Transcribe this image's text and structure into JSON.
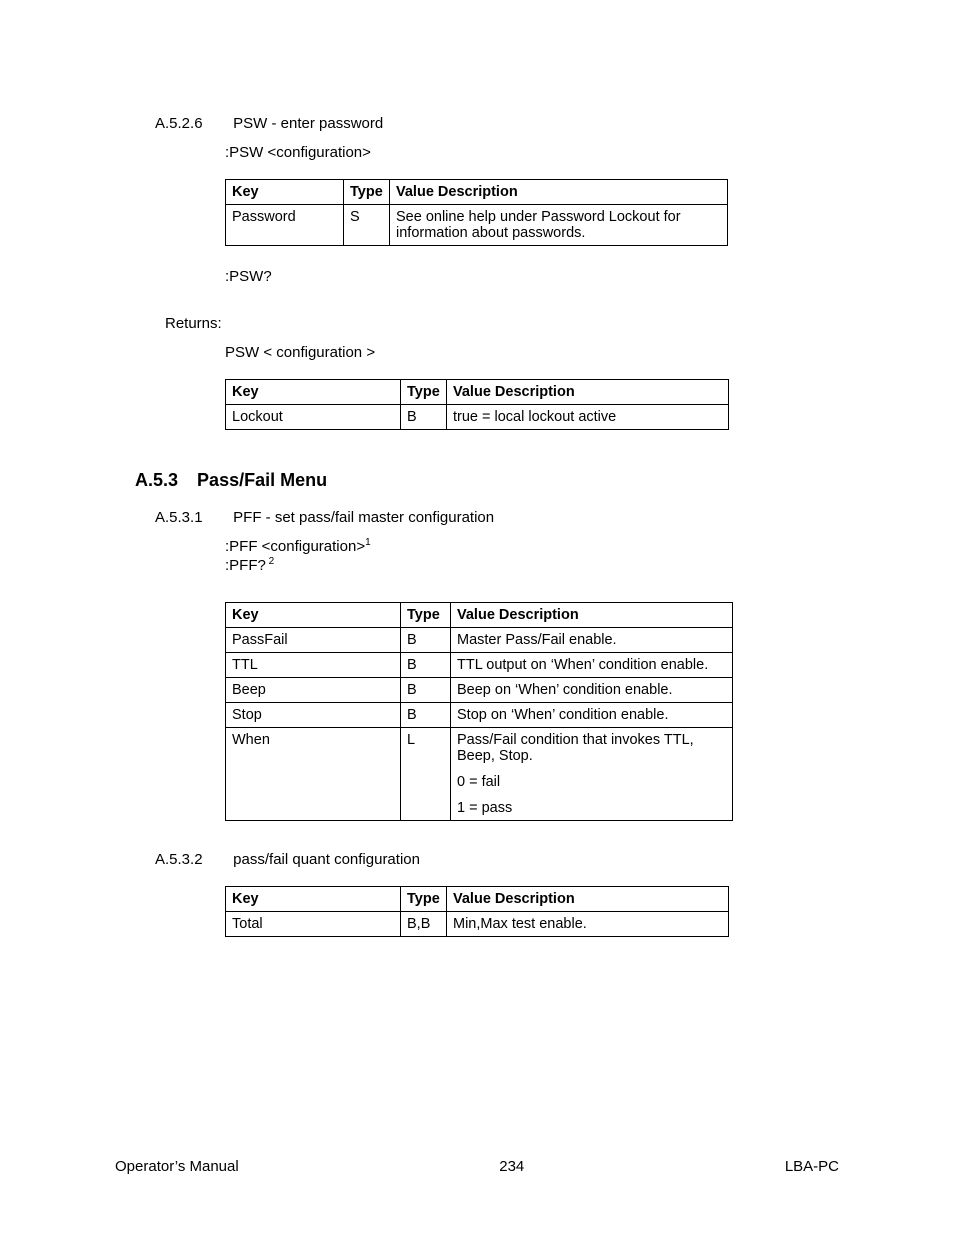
{
  "section_a526": {
    "num": "A.5.2.6",
    "title": "PSW - enter password",
    "line1": ":PSW <configuration>",
    "table": {
      "h_key": "Key",
      "h_type": "Type",
      "h_val": "Value Description",
      "r1_key": "Password",
      "r1_type": "S",
      "r1_val": "See online help under Password Lockout for information about passwords."
    },
    "line2": ":PSW?",
    "returns_label": "Returns:",
    "line3": "PSW < configuration >",
    "table2": {
      "h_key": "Key",
      "h_type": "Type",
      "h_val": "Value Description",
      "r1_key": "Lockout",
      "r1_type": "B",
      "r1_val": "true = local lockout active"
    }
  },
  "section_a53": {
    "num": "A.5.3",
    "title": "Pass/Fail Menu"
  },
  "section_a531": {
    "num": "A.5.3.1",
    "title": "PFF - set pass/fail master configuration",
    "line1_pre": ":PFF <configuration>",
    "line1_sup": "1",
    "line2_pre": ":PFF?",
    "line2_sup": " 2",
    "table": {
      "h_key": "Key",
      "h_type": "Type",
      "h_val": "Value Description",
      "r1_key": "PassFail",
      "r1_type": "B",
      "r1_val": "Master Pass/Fail enable.",
      "r2_key": "TTL",
      "r2_type": "B",
      "r2_val": "TTL output on ‘When’ condition enable.",
      "r3_key": "Beep",
      "r3_type": "B",
      "r3_val": "Beep on ‘When’ condition enable.",
      "r4_key": "Stop",
      "r4_type": "B",
      "r4_val": "Stop on ‘When’ condition enable.",
      "r5_key": "When",
      "r5_type": "L",
      "r5_val_a": "Pass/Fail condition that invokes TTL, Beep, Stop.",
      "r5_val_b": "0 = fail",
      "r5_val_c": "1 = pass"
    }
  },
  "section_a532": {
    "num": "A.5.3.2",
    "title": "pass/fail quant configuration",
    "table": {
      "h_key": "Key",
      "h_type": "Type",
      "h_val": "Value Description",
      "r1_key": "Total",
      "r1_type": "B,B",
      "r1_val": "Min,Max test enable."
    }
  },
  "footer": {
    "left": "Operator’s Manual",
    "center": "234",
    "right": "LBA-PC"
  }
}
